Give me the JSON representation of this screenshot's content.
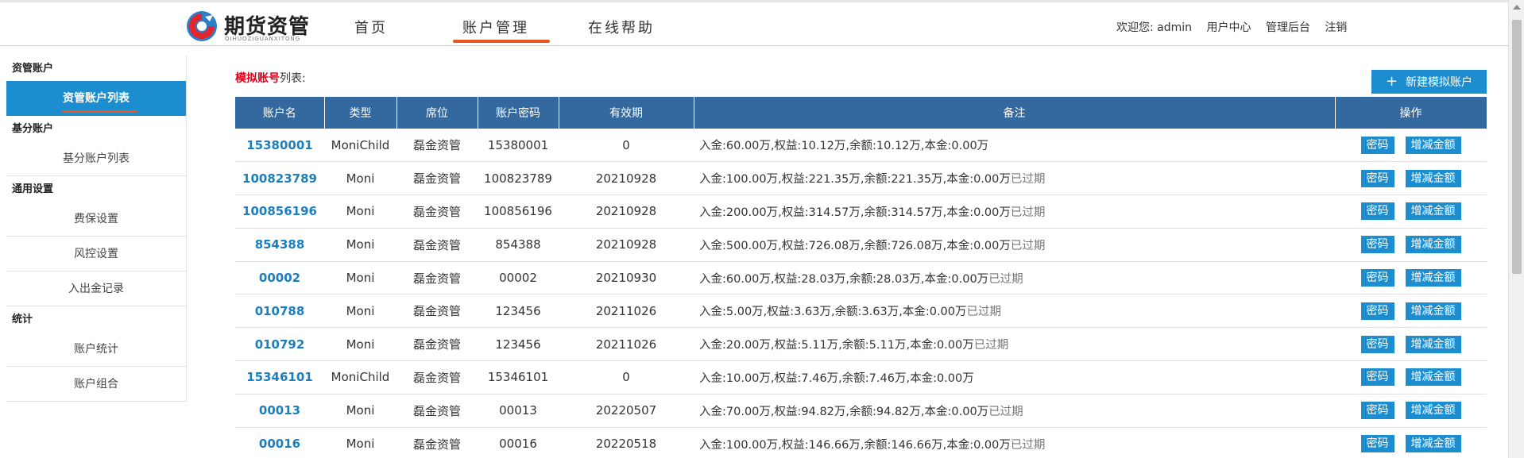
{
  "header": {
    "logo_title": "期货资管",
    "logo_sub": "QIHUOZIGUANXITONG",
    "nav": [
      {
        "label": "首页"
      },
      {
        "label": "账户管理"
      },
      {
        "label": "在线帮助"
      }
    ],
    "active_nav": "账户管理",
    "user": {
      "welcome": "欢迎您: admin",
      "user_center": "用户中心",
      "admin_panel": "管理后台",
      "logout": "注销"
    }
  },
  "sidebar": {
    "groups": [
      {
        "title": "资管账户",
        "items": [
          {
            "label": "资管账户列表",
            "active": true
          }
        ]
      },
      {
        "title": "基分账户",
        "items": [
          {
            "label": "基分账户列表",
            "active": false
          }
        ]
      },
      {
        "title": "通用设置",
        "items": [
          {
            "label": "费保设置",
            "active": false
          },
          {
            "label": "风控设置",
            "active": false
          },
          {
            "label": "入出金记录",
            "active": false
          }
        ]
      },
      {
        "title": "统计",
        "items": [
          {
            "label": "账户统计",
            "active": false
          },
          {
            "label": "账户组合",
            "active": false
          }
        ]
      }
    ]
  },
  "main": {
    "title_highlight": "模拟账号",
    "title_suffix": "列表:",
    "new_button": "新建模拟账户",
    "columns": [
      "账户名",
      "类型",
      "席位",
      "账户密码",
      "有效期",
      "备注",
      "操作"
    ],
    "op_password": "密码",
    "op_adjust": "增减金额",
    "rows": [
      {
        "name": "15380001",
        "type": "MoniChild",
        "seat": "磊金资管",
        "password": "15380001",
        "expiry": "0",
        "note": "入金:60.00万,权益:10.12万,余额:10.12万,本金:0.00万",
        "expired": ""
      },
      {
        "name": "100823789",
        "type": "Moni",
        "seat": "磊金资管",
        "password": "100823789",
        "expiry": "20210928",
        "note": "入金:100.00万,权益:221.35万,余额:221.35万,本金:0.00万",
        "expired": "已过期"
      },
      {
        "name": "100856196",
        "type": "Moni",
        "seat": "磊金资管",
        "password": "100856196",
        "expiry": "20210928",
        "note": "入金:200.00万,权益:314.57万,余额:314.57万,本金:0.00万",
        "expired": "已过期"
      },
      {
        "name": "854388",
        "type": "Moni",
        "seat": "磊金资管",
        "password": "854388",
        "expiry": "20210928",
        "note": "入金:500.00万,权益:726.08万,余额:726.08万,本金:0.00万",
        "expired": "已过期"
      },
      {
        "name": "00002",
        "type": "Moni",
        "seat": "磊金资管",
        "password": "00002",
        "expiry": "20210930",
        "note": "入金:60.00万,权益:28.03万,余额:28.03万,本金:0.00万",
        "expired": "已过期"
      },
      {
        "name": "010788",
        "type": "Moni",
        "seat": "磊金资管",
        "password": "123456",
        "expiry": "20211026",
        "note": "入金:5.00万,权益:3.63万,余额:3.63万,本金:0.00万",
        "expired": "已过期"
      },
      {
        "name": "010792",
        "type": "Moni",
        "seat": "磊金资管",
        "password": "123456",
        "expiry": "20211026",
        "note": "入金:20.00万,权益:5.11万,余额:5.11万,本金:0.00万",
        "expired": "已过期"
      },
      {
        "name": "15346101",
        "type": "MoniChild",
        "seat": "磊金资管",
        "password": "15346101",
        "expiry": "0",
        "note": "入金:10.00万,权益:7.46万,余额:7.46万,本金:0.00万",
        "expired": ""
      },
      {
        "name": "00013",
        "type": "Moni",
        "seat": "磊金资管",
        "password": "00013",
        "expiry": "20220507",
        "note": "入金:70.00万,权益:94.82万,余额:94.82万,本金:0.00万",
        "expired": "已过期"
      },
      {
        "name": "00016",
        "type": "Moni",
        "seat": "磊金资管",
        "password": "00016",
        "expiry": "20220518",
        "note": "入金:100.00万,权益:146.66万,余额:146.66万,本金:0.00万",
        "expired": "已过期"
      }
    ]
  }
}
